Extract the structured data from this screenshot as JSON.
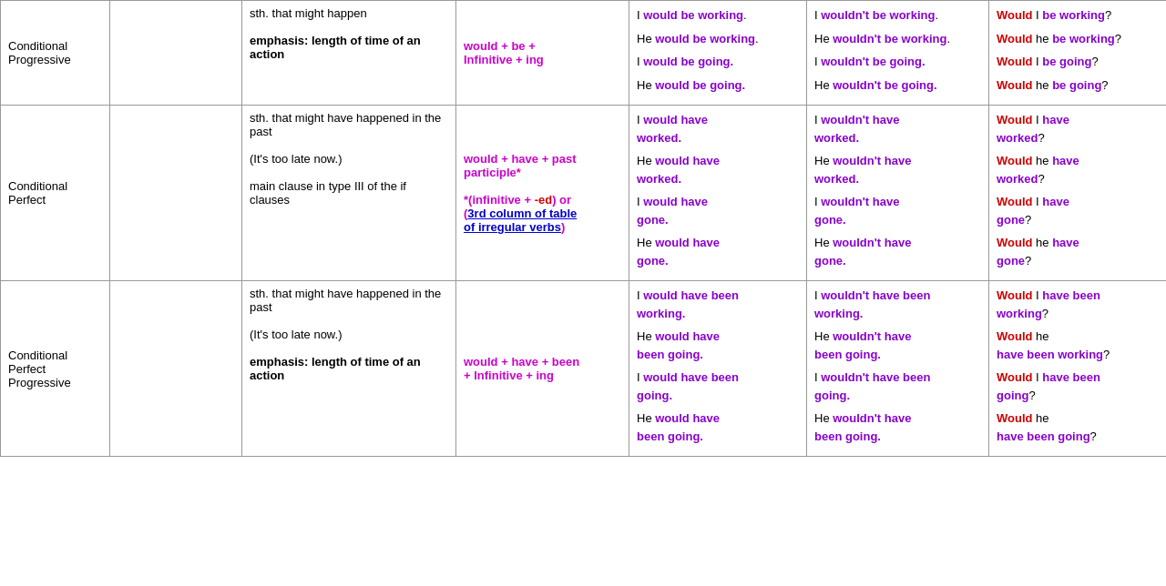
{
  "table": {
    "rows": [
      {
        "tense": "Conditional\nProgressive",
        "col2": "",
        "use": "sth. that might happen\n\nemphasis: length of time of an action",
        "formula_html": "<span class='magenta'>would</span> + <span class='magenta'>be</span> +<br><span class='magenta'>Infinitive</span> + <span class='magenta'>ing</span>",
        "affirmative": [
          "I <b class='purple'>would be working</b>.",
          "He <b class='purple'>would be working</b>.",
          "I <b class='purple'>would be going.</b>",
          "He <b class='purple'>would be going.</b>"
        ],
        "negative": [
          "I <b class='purple'>wouldn't be working</b>.",
          "He <b class='purple'>wouldn't be working</b>.",
          "I <b class='purple'>wouldn't be going.</b>",
          "He <b class='purple'>wouldn't be going.</b>"
        ],
        "question": [
          "<b class='red-q'>Would</b> I <b class='purple'>be working</b>?",
          "<b class='red-q'>Would</b> he <b class='purple'>be working</b>?",
          "<b class='red-q'>Would</b> I <b class='purple'>be going</b>?",
          "<b class='red-q'>Would</b> he <b class='purple'>be going</b>?"
        ]
      },
      {
        "tense": "Conditional\nPerfect",
        "col2": "",
        "use": "sth. that might have happened in the past\n\n(It's too late now.)\n\nmain clause in type III of the if clauses",
        "formula_html": "<span class='magenta'>would</span> + <span class='magenta'>have</span> + <span class='magenta'>past participle</span>*<br><br>*(<span class='magenta'>infinitive</span> + <span class='red-q'>-ed</span>) or (<span class='blue-link'>3rd column of table of irregular verbs</span>)",
        "affirmative": [
          "I <b class='purple'>would have worked.</b>",
          "He <b class='purple'>would have worked.</b>",
          "I <b class='purple'>would have gone.</b>",
          "He <b class='purple'>would have gone.</b>"
        ],
        "negative": [
          "I <b class='purple'>wouldn't have worked.</b>",
          "He <b class='purple'>wouldn't have worked.</b>",
          "I <b class='purple'>wouldn't have gone.</b>",
          "He <b class='purple'>wouldn't have gone.</b>"
        ],
        "question": [
          "<b class='red-q'>Would</b> I <b class='purple'>have worked</b>?",
          "<b class='red-q'>Would</b> he <b class='purple'>have worked</b>?",
          "<b class='red-q'>Would</b> I <b class='purple'>have gone</b>?",
          "<b class='red-q'>Would</b> he <b class='purple'>have gone</b>?"
        ]
      },
      {
        "tense": "Conditional\nPerfect\nProgressive",
        "col2": "",
        "use": "sth. that might have happened in the past\n\n(It's too late now.)\n\nemphasis: length of time of an action",
        "formula_html": "<span class='magenta'>would</span> + <span class='magenta'>have</span> + <span class='magenta'>been</span><br>+ <span class='magenta'>Infinitive</span> + <span class='magenta'>ing</span>",
        "affirmative": [
          "I <b class='purple'>would have been working.</b>",
          "He <b class='purple'>would have been going.</b>",
          "I <b class='purple'>would have been going.</b>",
          "He <b class='purple'>would have been going.</b>"
        ],
        "negative": [
          "I <b class='purple'>wouldn't have been working.</b>",
          "He <b class='purple'>wouldn't have been going.</b>",
          "I <b class='purple'>wouldn't have been going.</b>",
          "He <b class='purple'>wouldn't have been going.</b>"
        ],
        "question": [
          "<b class='red-q'>Would</b> I <b class='purple'>have been working</b>?",
          "<b class='red-q'>Would</b> he <b class='purple'>have been working</b>?",
          "<b class='red-q'>Would</b> I <b class='purple'>have been going</b>?",
          "<b class='red-q'>Would</b> he <b class='purple'>have been going</b>?"
        ]
      }
    ]
  }
}
